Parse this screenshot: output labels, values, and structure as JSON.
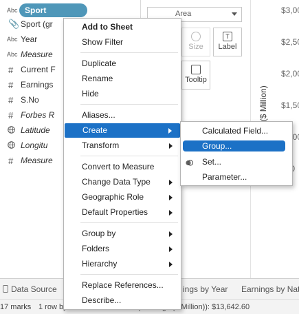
{
  "data_pane": {
    "fields": [
      {
        "type": "Abc",
        "name": "Sport",
        "selected": true
      },
      {
        "type": "clip",
        "name": "Sport (gr"
      },
      {
        "type": "Abc",
        "name": "Year"
      },
      {
        "type": "Abc",
        "name": "Measure",
        "italic": true
      },
      {
        "type": "#",
        "name": "Current F"
      },
      {
        "type": "#",
        "name": "Earnings"
      },
      {
        "type": "#",
        "name": "S.No"
      },
      {
        "type": "#",
        "name": "Forbes R",
        "italic": true
      },
      {
        "type": "globe",
        "name": "Latitude",
        "italic": true
      },
      {
        "type": "globe",
        "name": "Longitu",
        "italic": true
      },
      {
        "type": "#",
        "name": "Measure",
        "italic": true
      }
    ]
  },
  "marks_card": {
    "mark_type": "Area",
    "size_label": "Size",
    "label_label": "Label",
    "tooltip_label": "Tooltip"
  },
  "chart": {
    "y_axis_label": "Earnings ($ Million)",
    "y_ticks": [
      "$3,00",
      "$2,50",
      "$2,00",
      "$1,50",
      "$1,00",
      "$50"
    ]
  },
  "context_menu": {
    "items": [
      {
        "label": "Add to Sheet",
        "bold": true
      },
      {
        "label": "Show Filter"
      },
      {
        "label": "Duplicate"
      },
      {
        "label": "Rename"
      },
      {
        "label": "Hide"
      },
      {
        "label": "Aliases..."
      },
      {
        "label": "Create",
        "submenu": true,
        "highlighted": true
      },
      {
        "label": "Transform",
        "submenu": true
      },
      {
        "label": "Convert to Measure"
      },
      {
        "label": "Change Data Type",
        "submenu": true
      },
      {
        "label": "Geographic Role",
        "submenu": true
      },
      {
        "label": "Default Properties",
        "submenu": true
      },
      {
        "label": "Group by",
        "submenu": true
      },
      {
        "label": "Folders",
        "submenu": true
      },
      {
        "label": "Hierarchy",
        "submenu": true
      },
      {
        "label": "Replace References..."
      },
      {
        "label": "Describe..."
      }
    ]
  },
  "create_submenu": {
    "items": [
      {
        "label": "Calculated Field..."
      },
      {
        "label": "Group...",
        "highlighted": true
      },
      {
        "label": "Set..."
      },
      {
        "label": "Parameter..."
      }
    ]
  },
  "tabs": {
    "data_source": "Data Source",
    "sheet_1": "ings by Year",
    "sheet_2": "Earnings by Nat"
  },
  "status": {
    "marks": "17 marks",
    "rows_cols": "1 row by 17 columns",
    "sum": "SUM(Earnings ($ Million)): $13,642.60"
  },
  "colors": {
    "selected_pill": "#4f97b9",
    "menu_highlight": "#1c71c6"
  }
}
